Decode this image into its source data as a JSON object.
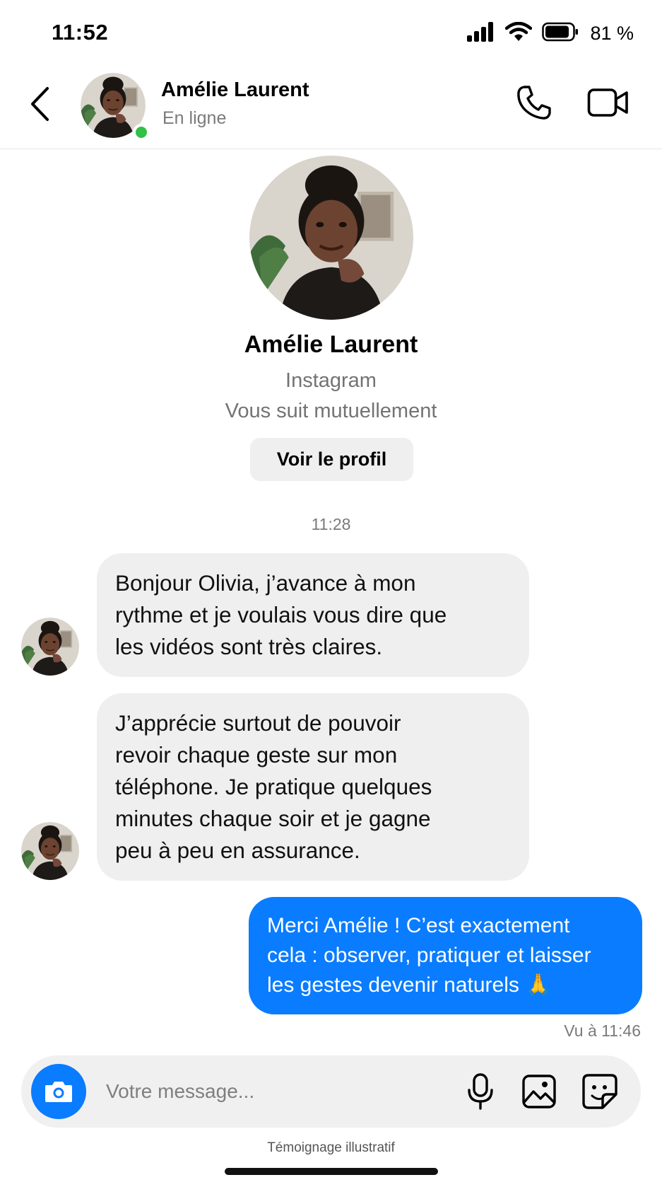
{
  "status_bar": {
    "time": "11:52",
    "battery_percent": "81 %",
    "icons": [
      "cellular-signal-icon",
      "wifi-icon",
      "battery-icon"
    ]
  },
  "header": {
    "contact_name": "Amélie Laurent",
    "presence": "En ligne",
    "icons": [
      "back-chevron-icon",
      "phone-call-icon",
      "video-call-icon"
    ],
    "online_color": "#31c048"
  },
  "profile": {
    "name": "Amélie Laurent",
    "source": "Instagram",
    "relation": "Vous suit mutuellement",
    "button_label": "Voir le profil"
  },
  "conversation": {
    "timestamp": "11:28",
    "messages": [
      {
        "direction": "incoming",
        "lines": [
          "Bonjour Olivia, j’avance à mon",
          "rythme et je voulais vous dire que",
          "les vidéos sont très claires."
        ]
      },
      {
        "direction": "incoming",
        "lines": [
          "J’apprécie surtout de pouvoir",
          "revoir chaque geste sur mon",
          "téléphone. Je pratique quelques",
          "minutes chaque soir et je gagne",
          "peu à peu en assurance."
        ]
      },
      {
        "direction": "outgoing",
        "lines": [
          "Merci Amélie ! C’est exactement",
          "cela : observer, pratiquer et laisser",
          "les gestes devenir naturels 🙏"
        ]
      }
    ],
    "seen_label": "Vu à 11:46"
  },
  "composer": {
    "placeholder": "Votre message...",
    "icons": [
      "camera-icon",
      "microphone-icon",
      "gallery-icon",
      "sticker-icon"
    ],
    "accent_color": "#0a7cff"
  },
  "footnote": "Témoignage illustratif"
}
